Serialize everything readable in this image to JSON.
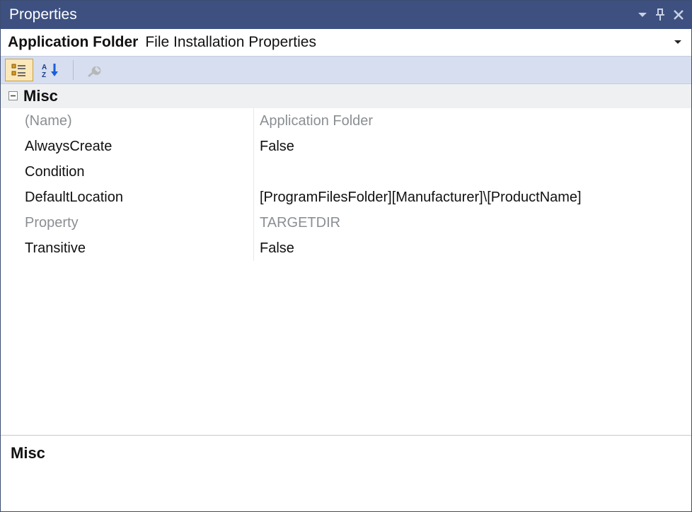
{
  "window": {
    "title": "Properties"
  },
  "object": {
    "name": "Application Folder",
    "type": "File Installation Properties"
  },
  "category": {
    "label": "Misc"
  },
  "rows": {
    "r0": {
      "name": "(Name)",
      "value": "Application Folder",
      "readonly": true
    },
    "r1": {
      "name": "AlwaysCreate",
      "value": "False",
      "readonly": false
    },
    "r2": {
      "name": "Condition",
      "value": "",
      "readonly": false
    },
    "r3": {
      "name": "DefaultLocation",
      "value": "[ProgramFilesFolder][Manufacturer]\\[ProductName]",
      "readonly": false
    },
    "r4": {
      "name": "Property",
      "value": "TARGETDIR",
      "readonly": true
    },
    "r5": {
      "name": "Transitive",
      "value": "False",
      "readonly": false
    }
  },
  "description": {
    "title": "Misc"
  }
}
